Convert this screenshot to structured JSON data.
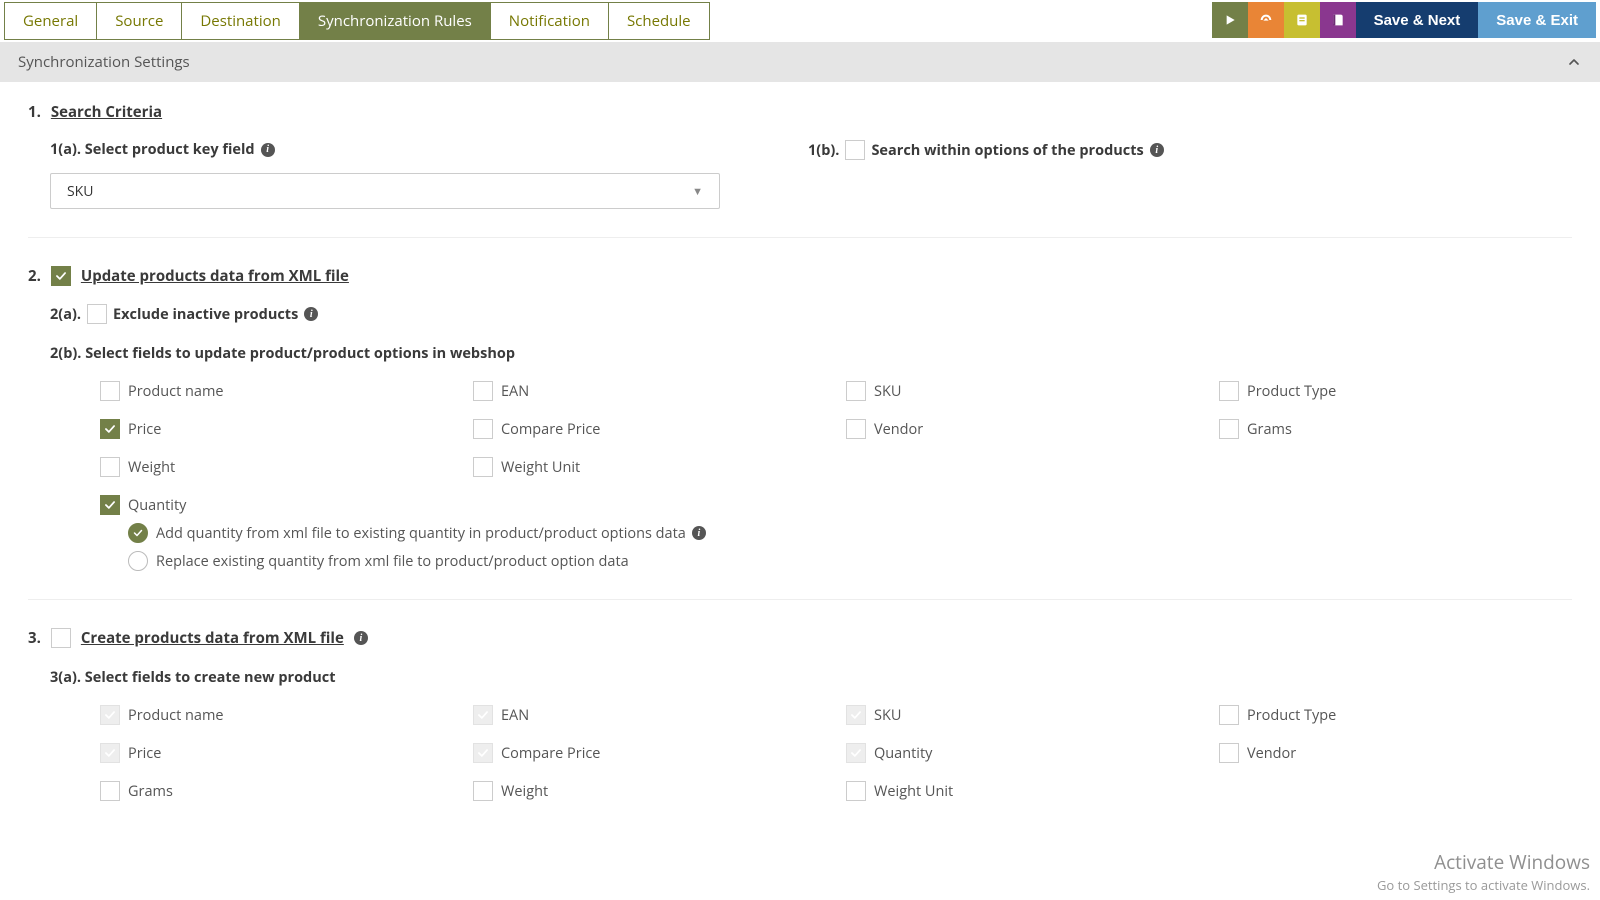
{
  "tabs": {
    "general": "General",
    "source": "Source",
    "destination": "Destination",
    "sync_rules": "Synchronization Rules",
    "notification": "Notification",
    "schedule": "Schedule"
  },
  "actions": {
    "save_next": "Save & Next",
    "save_exit": "Save & Exit"
  },
  "accordion": {
    "title": "Synchronization Settings"
  },
  "section1": {
    "num": "1.",
    "title": "Search Criteria",
    "a_label": "1(a). Select product key field",
    "select_value": "SKU",
    "b_label_prefix": "1(b).",
    "b_label_text": "Search within options of the products"
  },
  "section2": {
    "num": "2.",
    "title": "Update products data from XML file",
    "a_prefix": "2(a).",
    "a_text": "Exclude inactive products",
    "b_text": "2(b). Select fields to update product/product options in webshop",
    "fields": {
      "product_name": "Product name",
      "ean": "EAN",
      "sku": "SKU",
      "product_type": "Product Type",
      "price": "Price",
      "compare_price": "Compare Price",
      "vendor": "Vendor",
      "grams": "Grams",
      "weight": "Weight",
      "weight_unit": "Weight Unit",
      "quantity": "Quantity"
    },
    "radio_add": "Add quantity from xml file to existing quantity in product/product options data",
    "radio_replace": "Replace existing quantity from xml file to product/product option data"
  },
  "section3": {
    "num": "3.",
    "title": "Create products data from XML file",
    "a_text": "3(a). Select fields to create new product",
    "fields": {
      "product_name": "Product name",
      "ean": "EAN",
      "sku": "SKU",
      "product_type": "Product Type",
      "price": "Price",
      "compare_price": "Compare Price",
      "quantity": "Quantity",
      "vendor": "Vendor",
      "grams": "Grams",
      "weight": "Weight",
      "weight_unit": "Weight Unit"
    }
  },
  "watermark": {
    "line1": "Activate Windows",
    "line2": "Go to Settings to activate Windows."
  }
}
